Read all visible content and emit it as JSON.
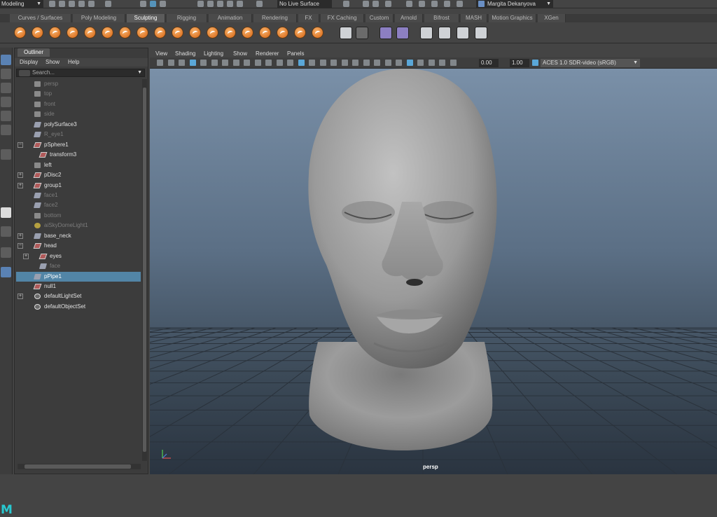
{
  "topbar": {
    "mode": "Modeling",
    "live_surface": "No Live Surface",
    "user": "Margita Dekanyova"
  },
  "shelf": {
    "tabs": [
      "Curves / Surfaces",
      "Poly Modeling",
      "Sculpting",
      "Rigging",
      "Animation",
      "Rendering",
      "FX",
      "FX Caching",
      "Custom",
      "Arnold",
      "Bifrost",
      "MASH",
      "Motion Graphics",
      "XGen"
    ],
    "active_tab": "Sculpting"
  },
  "outliner": {
    "tab": "Outliner",
    "menu": [
      "Display",
      "Show",
      "Help"
    ],
    "search_placeholder": "Search...",
    "items": [
      {
        "label": "persp",
        "icon": "camera-icon",
        "dim": true
      },
      {
        "label": "top",
        "icon": "camera-icon",
        "dim": true
      },
      {
        "label": "front",
        "icon": "camera-icon",
        "dim": true
      },
      {
        "label": "side",
        "icon": "camera-icon",
        "dim": true
      },
      {
        "label": "polySurface3",
        "icon": "mesh-icon",
        "dim": false
      },
      {
        "label": "R_eye1",
        "icon": "mesh-icon",
        "dim": true
      },
      {
        "label": "pSphere1",
        "icon": "transform-icon",
        "dim": false,
        "expand": "minus"
      },
      {
        "label": "transform3",
        "icon": "transform-icon",
        "dim": false
      },
      {
        "label": "left",
        "icon": "camera-icon",
        "dim": false
      },
      {
        "label": "pDisc2",
        "icon": "transform-icon",
        "dim": false,
        "expand": "plus"
      },
      {
        "label": "group1",
        "icon": "transform-icon",
        "dim": false,
        "expand": "plus"
      },
      {
        "label": "face1",
        "icon": "mesh-icon",
        "dim": true
      },
      {
        "label": "face2",
        "icon": "mesh-icon",
        "dim": true
      },
      {
        "label": "bottom",
        "icon": "camera-icon",
        "dim": true
      },
      {
        "label": "aiSkyDomeLight1",
        "icon": "light-icon",
        "dim": true
      },
      {
        "label": "base_neck",
        "icon": "mesh-icon",
        "dim": false,
        "expand": "plus"
      },
      {
        "label": "head",
        "icon": "transform-icon",
        "dim": false,
        "expand": "minus"
      },
      {
        "label": "eyes",
        "icon": "transform-icon",
        "dim": false,
        "expand": "plus"
      },
      {
        "label": "face",
        "icon": "mesh-icon",
        "dim": true
      },
      {
        "label": "pPipe1",
        "icon": "mesh-icon",
        "dim": false,
        "selected": true
      },
      {
        "label": "null1",
        "icon": "transform-icon",
        "dim": false
      },
      {
        "label": "defaultLightSet",
        "icon": "set-icon",
        "dim": false,
        "expand": "plus"
      },
      {
        "label": "defaultObjectSet",
        "icon": "set-icon",
        "dim": false
      }
    ]
  },
  "viewport": {
    "menus": [
      "View",
      "Shading",
      "Lighting",
      "Show",
      "Renderer",
      "Panels"
    ],
    "exposure": "0.00",
    "gamma": "1.00",
    "color_management": "ACES 1.0 SDR-video (sRGB)",
    "camera": "persp",
    "colors": {
      "background_top": "#7a90a8",
      "background_bottom": "#2a3440",
      "grid": "#2a323b",
      "model": "#9a9a9a"
    }
  }
}
